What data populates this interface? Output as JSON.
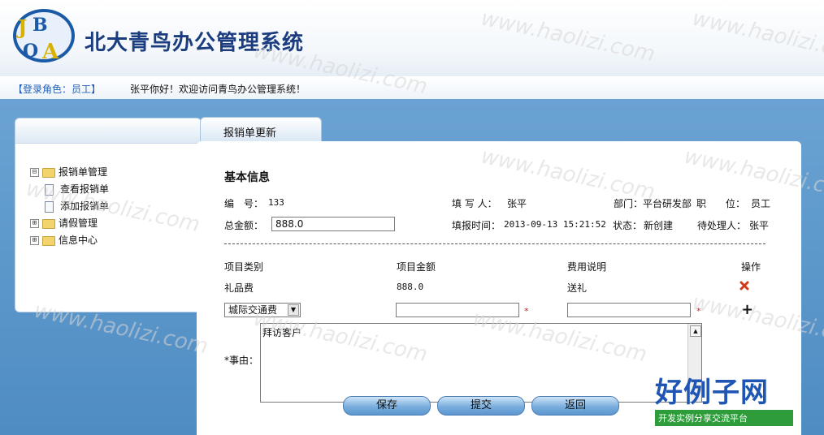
{
  "app": {
    "title": "北大青鸟办公管理系统",
    "logo_text": "JBOA"
  },
  "infobar": {
    "role": "【登录角色：员工】",
    "welcome": "张平你好！欢迎访问青鸟办公管理系统！"
  },
  "sidebar": {
    "items": [
      {
        "label": "报销单管理",
        "expander": "⊟",
        "children": [
          {
            "label": "查看报销单"
          },
          {
            "label": "添加报销单"
          }
        ]
      },
      {
        "label": "请假管理",
        "expander": "⊞"
      },
      {
        "label": "信息中心",
        "expander": "⊞"
      }
    ]
  },
  "tab": {
    "label": "报销单更新"
  },
  "form": {
    "section_title": "基本信息",
    "number_label": "编　号：",
    "number_value": "133",
    "writer_label": "填 写 人：",
    "writer_value": "张平",
    "dept_label": "部门：",
    "dept_value": "平台研发部",
    "position_label": "职　　位：",
    "position_value": "员工",
    "total_label": "总金额：",
    "total_value": "888.0",
    "time_label": "填报时间：",
    "time_value": "2013-09-13 15:21:52",
    "status_label": "状态：",
    "status_value": "新创建",
    "handler_label": "待处理人：",
    "handler_value": "张平",
    "columns": [
      "项目类别",
      "项目金额",
      "费用说明",
      "操作"
    ],
    "rows": [
      {
        "category": "礼品费",
        "amount": "888.0",
        "desc": "送礼"
      }
    ],
    "new_row": {
      "category_selected": "城际交通费",
      "amount": "",
      "desc": ""
    },
    "reason_label": "*事由：",
    "reason_value": "拜访客户",
    "buttons": {
      "save": "保存",
      "submit": "提交",
      "back": "返回"
    }
  },
  "watermark": {
    "text": "www.haolizi.com",
    "brand": "好例子网",
    "brand_sub": "开发实例分享交流平台"
  },
  "colors": {
    "accent": "#1f5fb8",
    "background": "#5b9bd5",
    "button": "#7aaedd"
  }
}
